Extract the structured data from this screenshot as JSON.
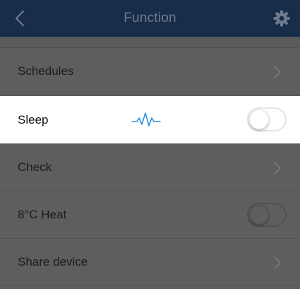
{
  "navbar": {
    "title": "Function",
    "back_icon": "chevron-left-icon",
    "settings_icon": "gear-icon",
    "color": "#172d4a"
  },
  "rows": [
    {
      "label": "Schedules",
      "control": "chevron-right-icon"
    },
    {
      "label": "Sleep",
      "control": "toggle",
      "toggle_on": false,
      "indicator_icon": "heartbeat-icon",
      "indicator_color": "#2a8fe0",
      "highlighted": true
    },
    {
      "label": "Check",
      "control": "chevron-right-icon"
    },
    {
      "label": "8°C Heat",
      "control": "toggle",
      "toggle_on": false
    },
    {
      "label": "Share device",
      "control": "chevron-right-icon"
    }
  ]
}
